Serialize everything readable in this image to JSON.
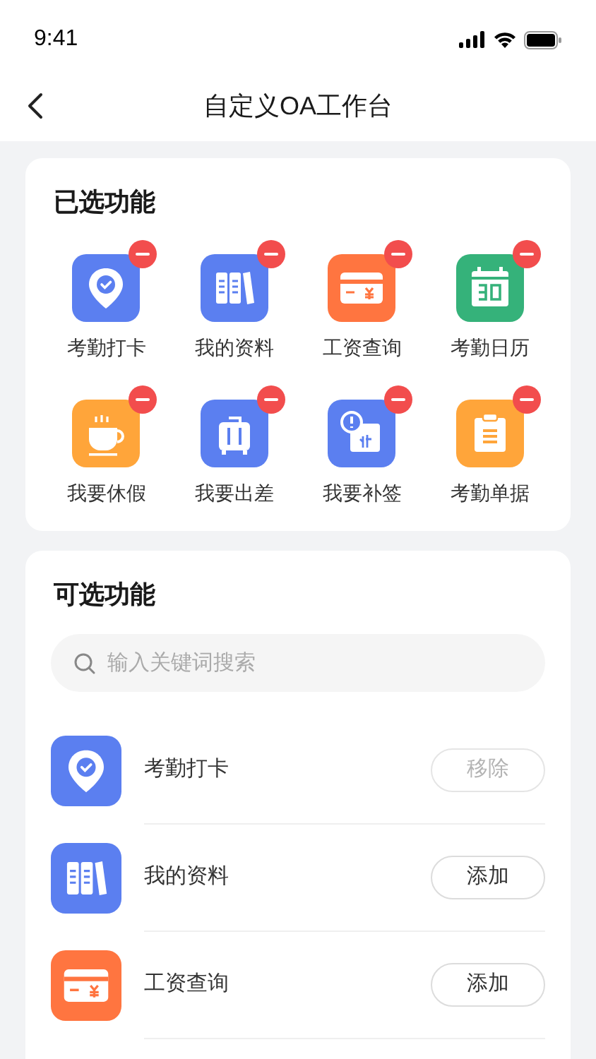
{
  "status_bar": {
    "time": "9:41"
  },
  "nav": {
    "title": "自定义OA工作台"
  },
  "selected_section": {
    "title": "已选功能",
    "items": [
      {
        "label": "考勤打卡",
        "kind": "pin",
        "color": "#5b7ff0"
      },
      {
        "label": "我的资料",
        "kind": "books",
        "color": "#5b7ff0"
      },
      {
        "label": "工资查询",
        "kind": "card",
        "color": "#ff7540"
      },
      {
        "label": "考勤日历",
        "kind": "calendar",
        "color": "#35b27a"
      },
      {
        "label": "我要休假",
        "kind": "cup",
        "color": "#ffa53a"
      },
      {
        "label": "我要出差",
        "kind": "suitcase",
        "color": "#5b7ff0"
      },
      {
        "label": "我要补签",
        "kind": "notice",
        "color": "#5b7ff0"
      },
      {
        "label": "考勤单据",
        "kind": "clipboard",
        "color": "#ffa53a"
      }
    ]
  },
  "available_section": {
    "title": "可选功能",
    "search": {
      "placeholder": "输入关键词搜索"
    },
    "items": [
      {
        "label": "考勤打卡",
        "kind": "pin",
        "color": "#5b7ff0",
        "button": "移除",
        "disabled": true
      },
      {
        "label": "我的资料",
        "kind": "books",
        "color": "#5b7ff0",
        "button": "添加",
        "disabled": false
      },
      {
        "label": "工资查询",
        "kind": "card",
        "color": "#ff7540",
        "button": "添加",
        "disabled": false
      }
    ]
  }
}
